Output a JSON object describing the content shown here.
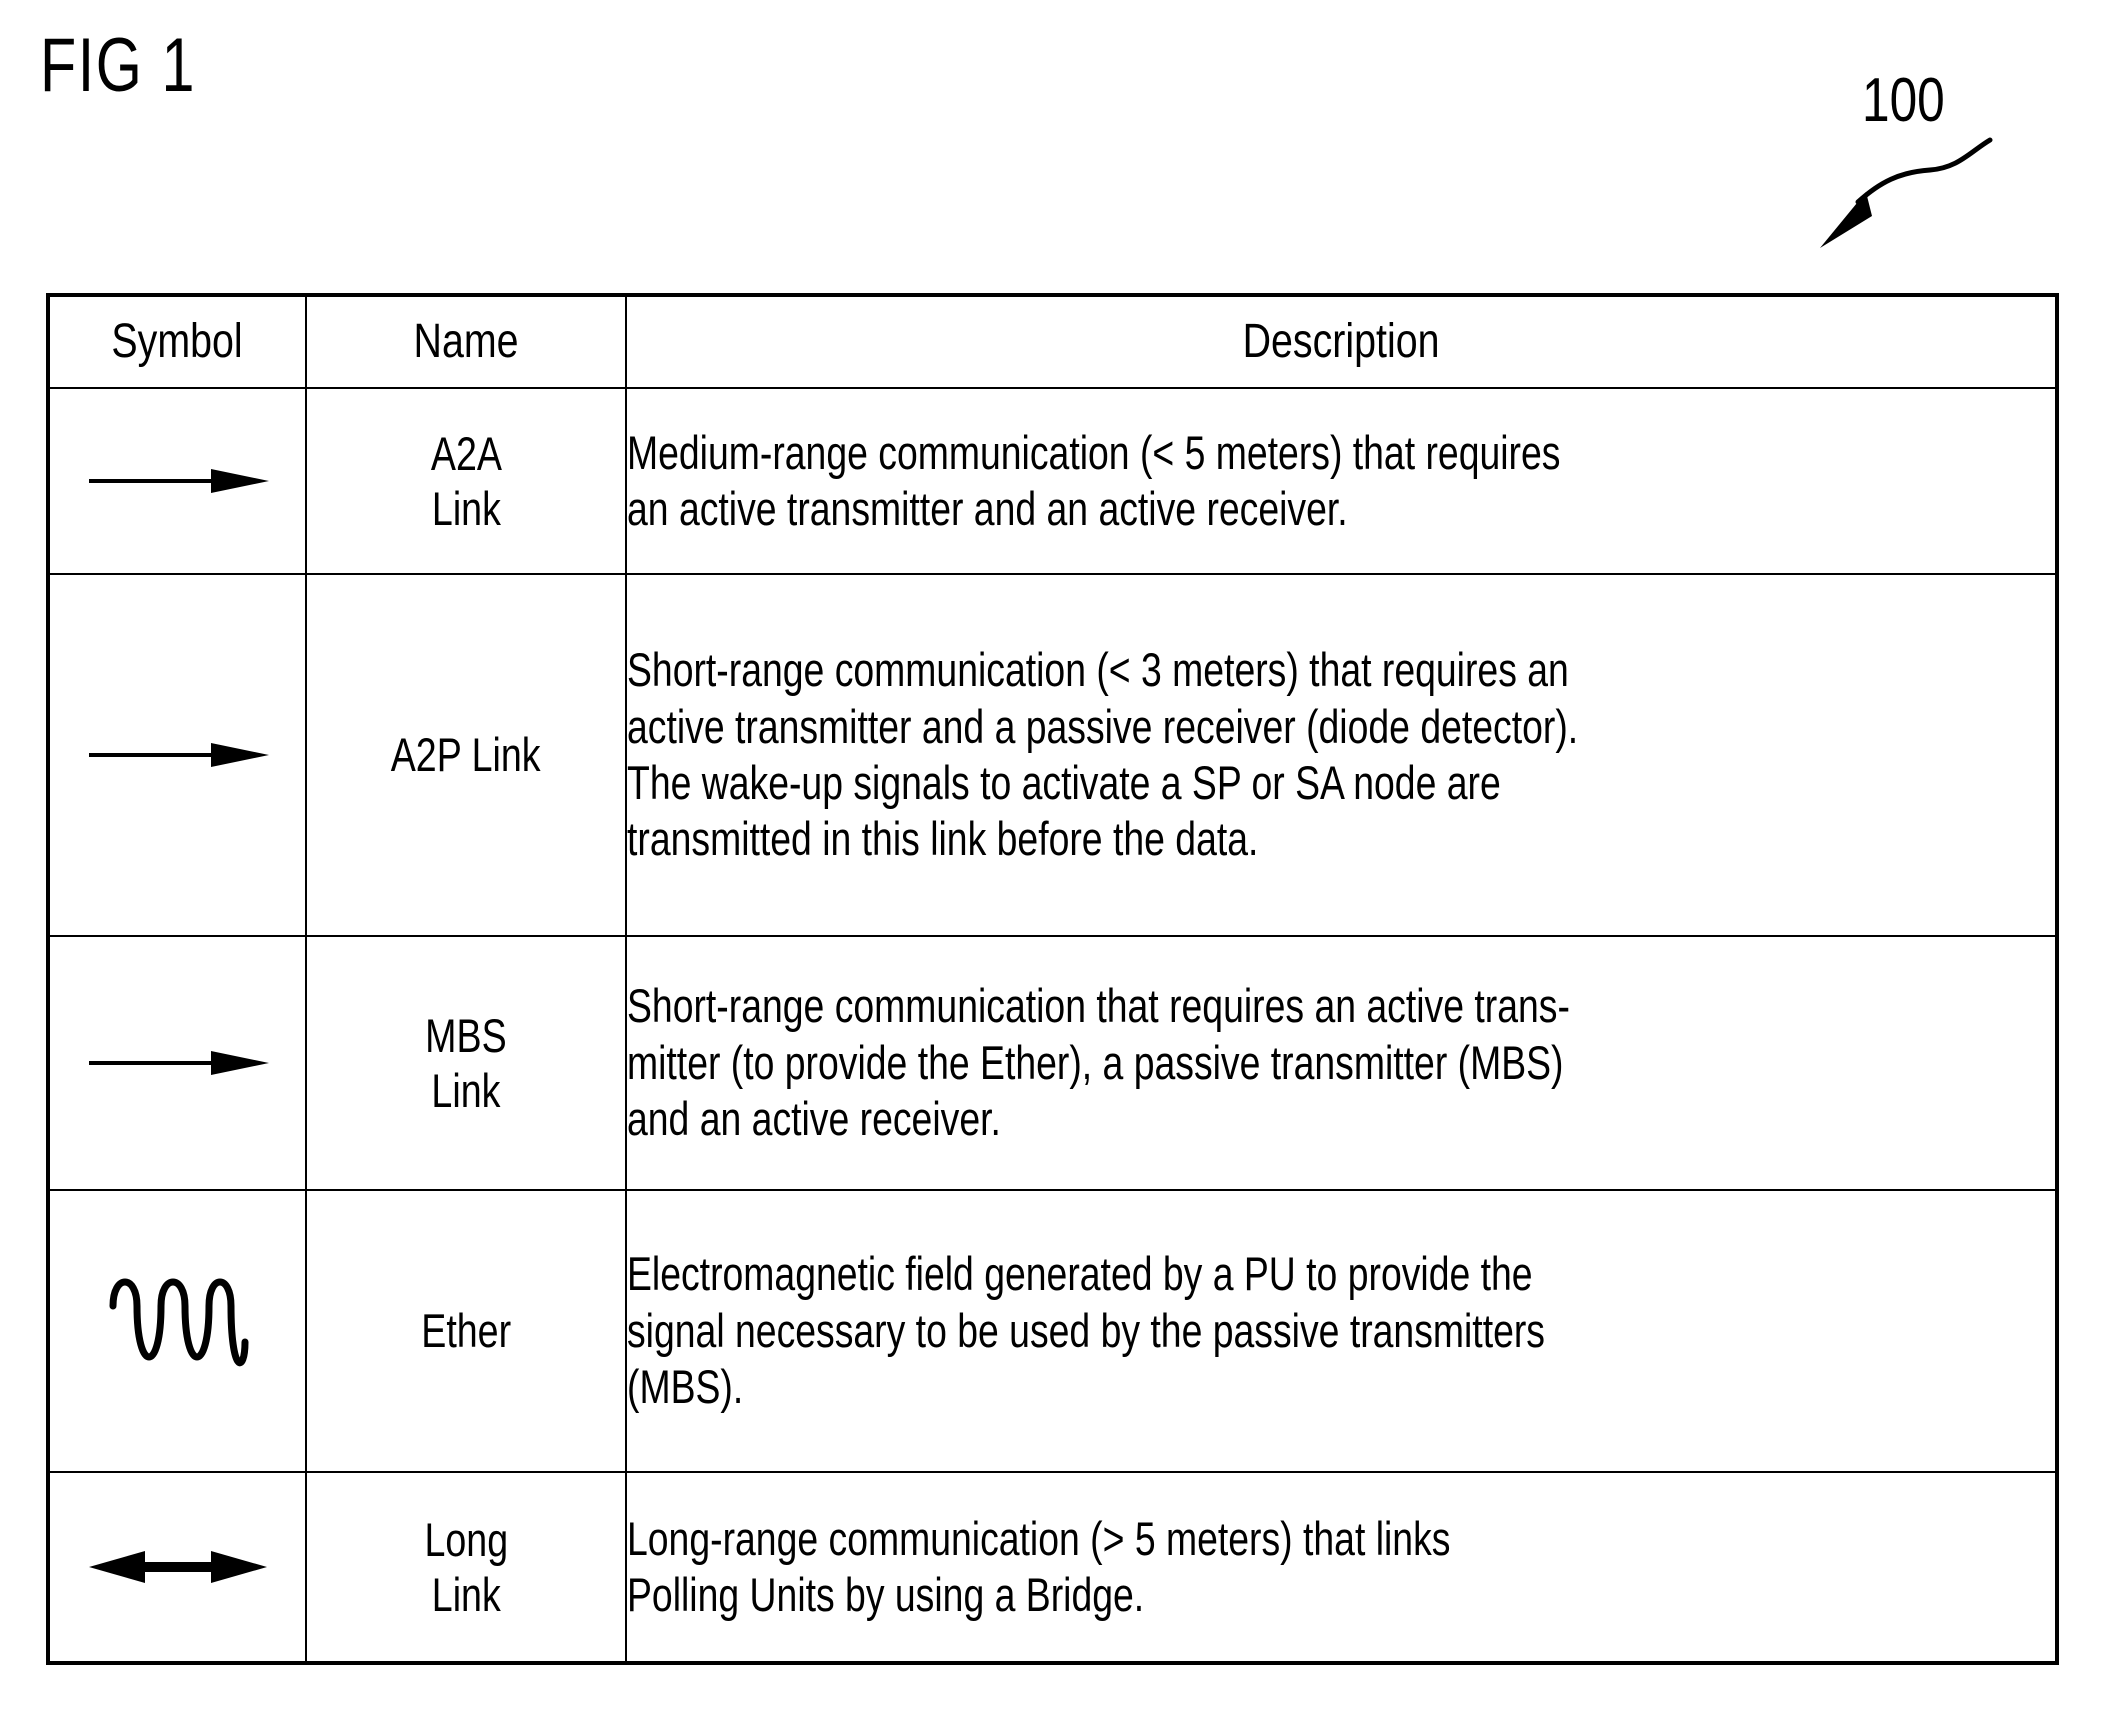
{
  "figure": {
    "label": "FIG 1",
    "reference_numeral": "100"
  },
  "table": {
    "headers": {
      "symbol": "Symbol",
      "name": "Name",
      "description": "Description"
    },
    "rows": [
      {
        "symbol_icon": "single-arrow-right-icon",
        "name": "A2A\nLink",
        "description": "Medium-range communication (< 5 meters) that requires\nan active transmitter and an active receiver."
      },
      {
        "symbol_icon": "single-arrow-right-icon",
        "name": "A2P Link",
        "description": "Short-range communication (< 3 meters) that requires an\nactive transmitter and a passive receiver (diode detector).\nThe wake-up signals to activate a SP or SA node are\ntransmitted in this link before the data."
      },
      {
        "symbol_icon": "single-arrow-right-icon",
        "name": "MBS\nLink",
        "description": "Short-range communication that requires an active trans-\nmitter (to provide the Ether), a passive transmitter (MBS)\nand an active receiver."
      },
      {
        "symbol_icon": "sine-wave-icon",
        "name": "Ether",
        "description": "Electromagnetic field generated by a PU to provide the\nsignal necessary to be used by the passive transmitters\n(MBS)."
      },
      {
        "symbol_icon": "double-arrow-icon",
        "name": "Long\nLink",
        "description": "Long-range communication (> 5 meters) that links\nPolling Units by using a Bridge."
      }
    ]
  },
  "colors": {
    "ink": "#000000",
    "paper": "#ffffff"
  }
}
